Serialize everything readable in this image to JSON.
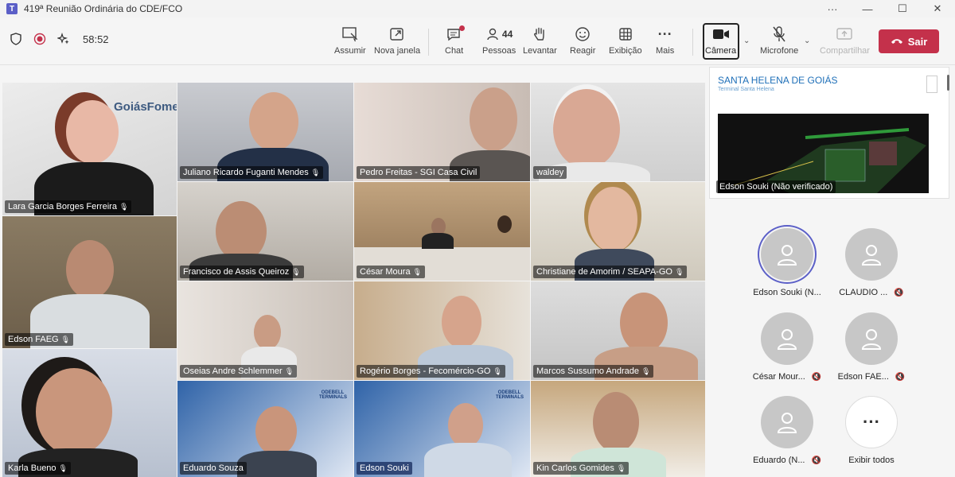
{
  "window": {
    "title": "419ª Reunião Ordinária do CDE/FCO",
    "controls": [
      "···",
      "—",
      "☐",
      "✕"
    ]
  },
  "toolbar": {
    "timer": "58:52",
    "share_label": "Assumir",
    "popout_label": "Nova janela",
    "chat_label": "Chat",
    "people_label": "Pessoas",
    "people_count": "44",
    "raise_label": "Levantar",
    "react_label": "Reagir",
    "view_label": "Exibição",
    "more_label": "Mais",
    "camera_label": "Câmera",
    "mic_label": "Microfone",
    "share_screen_label": "Compartilhar",
    "leave_label": "Sair"
  },
  "tiles": [
    {
      "name": "Lara Garcia Borges Ferreira",
      "logo": "GoiásFomento"
    },
    {
      "name": "Juliano Ricardo Fuganti Mendes"
    },
    {
      "name": "Pedro Freitas - SGI Casa Civil"
    },
    {
      "name": "waldey"
    },
    {
      "name": "Edson FAEG"
    },
    {
      "name": "Francisco de Assis Queiroz"
    },
    {
      "name": "César Moura"
    },
    {
      "name": "Christiane de Amorim / SEAPA-GO"
    },
    {
      "name": "Oseias Andre Schlemmer"
    },
    {
      "name": "Rogério Borges - Fecomércio-GO"
    },
    {
      "name": "Marcos Sussumo Andrade"
    },
    {
      "name": "Karla Bueno"
    },
    {
      "name": "Eduardo Souza",
      "logo": "ODEBELL TERMINALS"
    },
    {
      "name": "Edson Souki",
      "logo": "ODEBELL TERMINALS"
    },
    {
      "name": "Kin Carlos Gomides"
    }
  ],
  "share": {
    "title": "SANTA HELENA DE GOIÁS",
    "subtitle": "Terminal Santa Helena",
    "presenter": "Edson Souki (Não verificado)"
  },
  "participants": [
    {
      "name": "Edson Souki (N...",
      "muted": false,
      "active": true
    },
    {
      "name": "CLAUDIO ...",
      "muted": true,
      "active": false
    },
    {
      "name": "César Mour...",
      "muted": true,
      "active": false
    },
    {
      "name": "Edson FAE...",
      "muted": true,
      "active": false
    },
    {
      "name": "Eduardo (N...",
      "muted": true,
      "active": false
    }
  ],
  "show_all_label": "Exibir todos",
  "colors": {
    "accent": "#5b5fc7",
    "leave": "#c4314b",
    "link_blue": "#1e6fb8"
  }
}
